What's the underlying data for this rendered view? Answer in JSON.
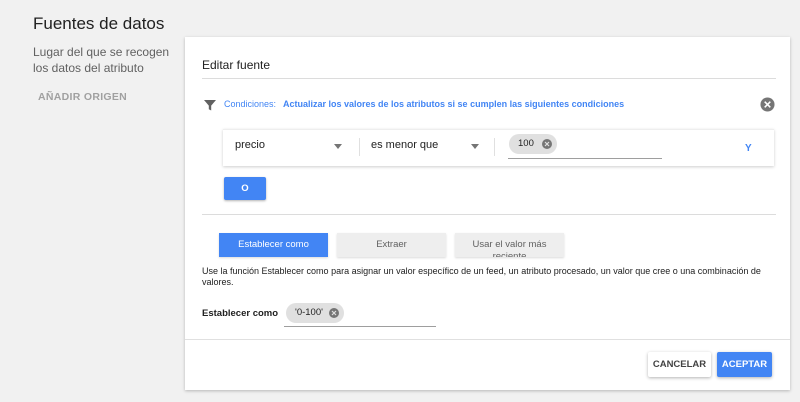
{
  "section": {
    "title": "Fuentes de datos",
    "description": "Lugar del que se recogen los datos del atributo",
    "add_origin": "AÑADIR ORIGEN"
  },
  "card": {
    "title": "Editar fuente",
    "conditions": {
      "label": "Condiciones:",
      "text": "Actualizar los valores de los atributos si se cumplen las siguientes condiciones"
    },
    "rule": {
      "field": "precio",
      "operator": "es menor que",
      "value": "100",
      "and_link": "Y"
    },
    "or_button": "O",
    "tabs": [
      {
        "label": "Establecer como",
        "active": true
      },
      {
        "label": "Extraer",
        "active": false
      },
      {
        "label": "Usar el valor más reciente",
        "active": false
      }
    ],
    "tab_description": "Use la función Establecer como para asignar un valor específico de un feed, un atributo procesado, un valor que cree o una combinación de valores.",
    "set_as": {
      "label": "Establecer como",
      "value": "'0-100'"
    },
    "cancel_button": "CANCELAR",
    "accept_button": "ACEPTAR"
  },
  "colors": {
    "accent": "#4285f4",
    "background": "#f1f1f1"
  }
}
